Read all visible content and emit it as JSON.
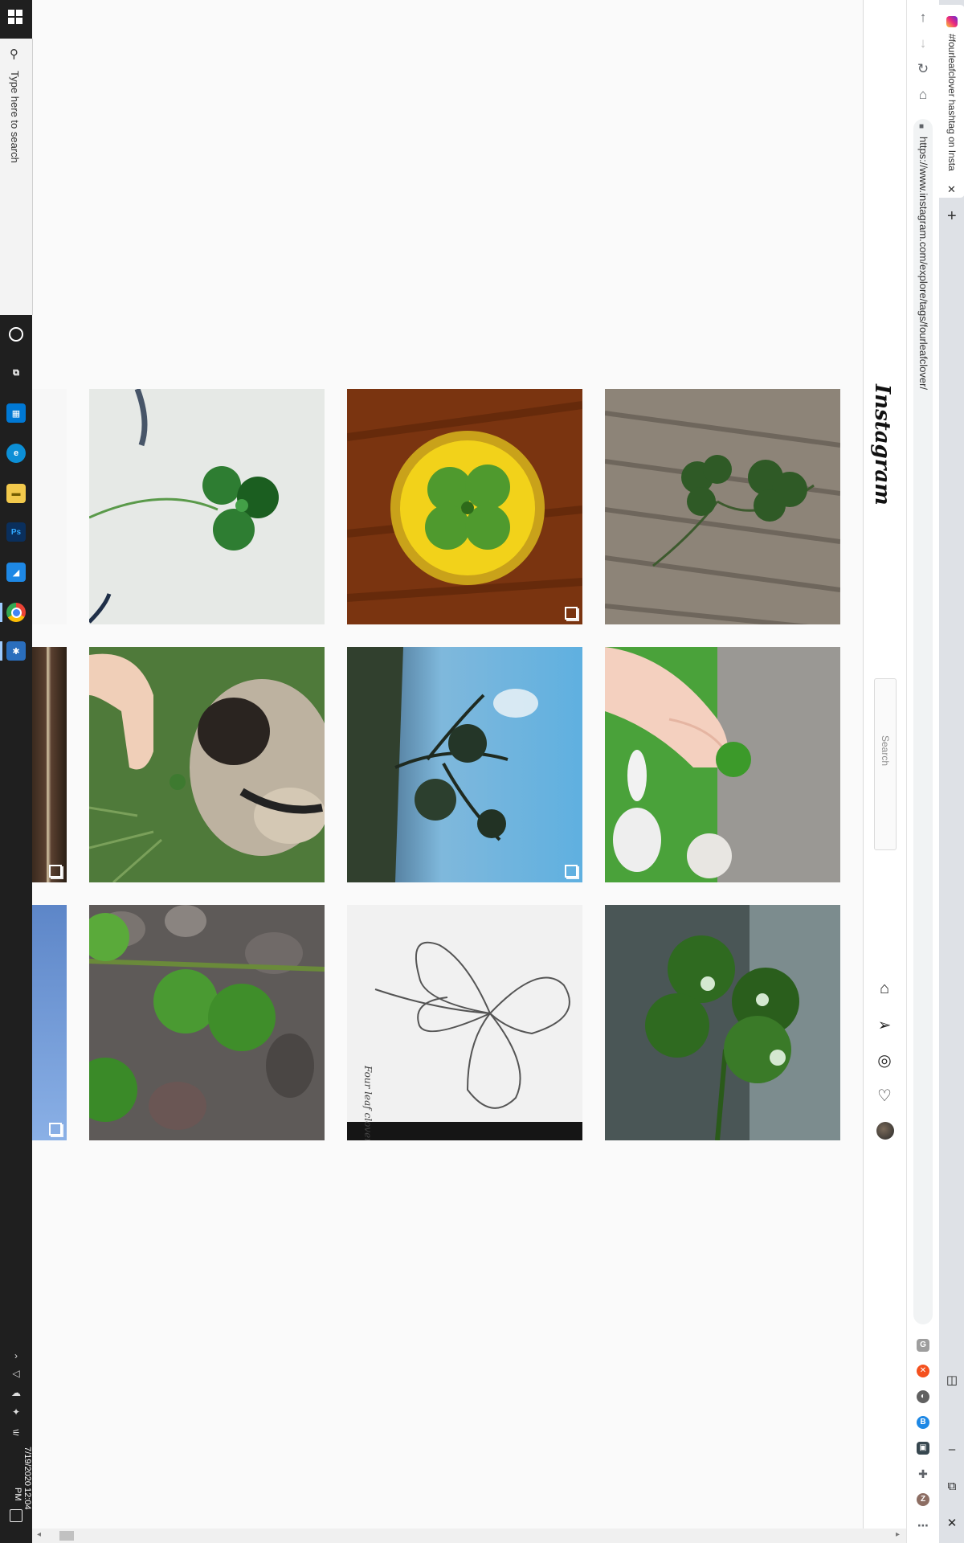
{
  "taskbar": {
    "search_placeholder": "Type here to search",
    "time": "12:04 PM",
    "date": "7/19/2020",
    "apps": [
      {
        "name": "cortana-icon",
        "glyph": "○",
        "color": "#1f1f1f"
      },
      {
        "name": "task-view-icon",
        "glyph": "⧉",
        "color": "#1f1f1f"
      },
      {
        "name": "store-icon",
        "glyph": "▦",
        "color": "#0078d4"
      },
      {
        "name": "edge-icon",
        "glyph": "e",
        "color": "#0c8fd6"
      },
      {
        "name": "file-explorer-icon",
        "glyph": "▬",
        "color": "#f2c94c"
      },
      {
        "name": "photoshop-icon",
        "glyph": "Ps",
        "color": "#0a2f5c"
      },
      {
        "name": "blue-app-icon",
        "glyph": "◢",
        "color": "#1e88e5"
      },
      {
        "name": "chrome-icon",
        "glyph": "●",
        "color": "#4caf50"
      },
      {
        "name": "settings-app-icon",
        "glyph": "✱",
        "color": "#2a6ebd"
      }
    ]
  },
  "browser": {
    "tab_title": "#fourleafclover hashtag on Insta",
    "url": "https://www.instagram.com/explore/tags/fourleafclover/",
    "nav_icons": [
      "back-icon",
      "forward-icon",
      "reload-icon",
      "bookmark-icon"
    ],
    "extensions": [
      {
        "name": "extension-g-icon",
        "glyph": "G",
        "color": "#9e9e9e"
      },
      {
        "name": "extension-orange-icon",
        "glyph": "✕",
        "color": "#f4511e"
      },
      {
        "name": "extension-circle-icon",
        "glyph": "◐",
        "color": "#616161"
      },
      {
        "name": "extension-blue-icon",
        "glyph": "B",
        "color": "#1e88e5"
      },
      {
        "name": "extension-photo-icon",
        "glyph": "▣",
        "color": "#37474f"
      },
      {
        "name": "extensions-puzzle-icon",
        "glyph": "✚",
        "color": "#5f6368"
      },
      {
        "name": "profile-avatar-icon",
        "glyph": "Z",
        "color": "#8d6e63"
      },
      {
        "name": "menu-icon",
        "glyph": "⋯",
        "color": "#ffffff"
      }
    ]
  },
  "instagram": {
    "logo": "Instagram",
    "search_placeholder": "Search",
    "nav_icons": [
      "home-icon",
      "direct-icon",
      "explore-icon",
      "activity-heart-icon"
    ]
  },
  "grid": [
    {
      "name": "post-clover-on-paper",
      "multi": false
    },
    {
      "name": "post-clover-resin-pendant",
      "multi": true
    },
    {
      "name": "post-clovers-on-wood",
      "multi": false
    },
    {
      "name": "post-pug-and-clover",
      "multi": false
    },
    {
      "name": "post-tree-and-sky",
      "multi": true
    },
    {
      "name": "post-hand-holding-clover",
      "multi": false
    },
    {
      "name": "post-clover-on-rocks",
      "multi": false
    },
    {
      "name": "post-clover-sketch",
      "multi": false
    },
    {
      "name": "post-clover-with-droplets",
      "multi": false
    }
  ],
  "sketch_caption": "Four leaf clover"
}
